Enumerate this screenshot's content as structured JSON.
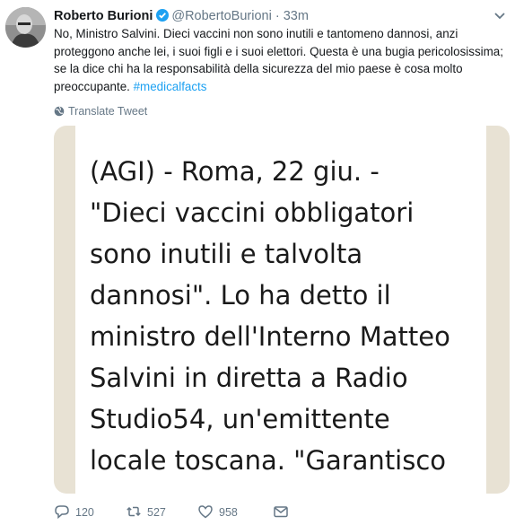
{
  "tweet": {
    "author_name": "Roberto Burioni",
    "handle": "@RobertoBurioni",
    "separator": "·",
    "time": "33m",
    "text": "No, Ministro Salvini. Dieci vaccini non sono inutili e tantomeno dannosi, anzi proteggono anche lei, i suoi figli e i suoi elettori. Questa è una bugia pericolosissima; se la dice chi ha la responsabilità della sicurezza del mio paese è cosa molto preoccupante.",
    "hashtag": "#medicalfacts",
    "translate_label": "Translate Tweet"
  },
  "media": {
    "lines": [
      "(AGI) - Roma, 22 giu. -",
      "\"Dieci vaccini obbligatori",
      "sono inutili e talvolta",
      "dannosi\". Lo ha detto il",
      "ministro dell'Interno Matteo",
      "Salvini in diretta a Radio",
      "Studio54, un'emittente",
      "locale toscana. \"Garantisco"
    ]
  },
  "actions": {
    "replies": "120",
    "retweets": "527",
    "likes": "958"
  },
  "colors": {
    "accent": "#1da1f2",
    "secondary_text": "#657786",
    "media_background": "#e8e2d4"
  },
  "icons": {
    "verified": "verified-badge-icon",
    "caret": "chevron-down-icon",
    "translate": "globe-icon",
    "reply": "reply-icon",
    "retweet": "retweet-icon",
    "like": "heart-icon",
    "dm": "envelope-icon"
  }
}
